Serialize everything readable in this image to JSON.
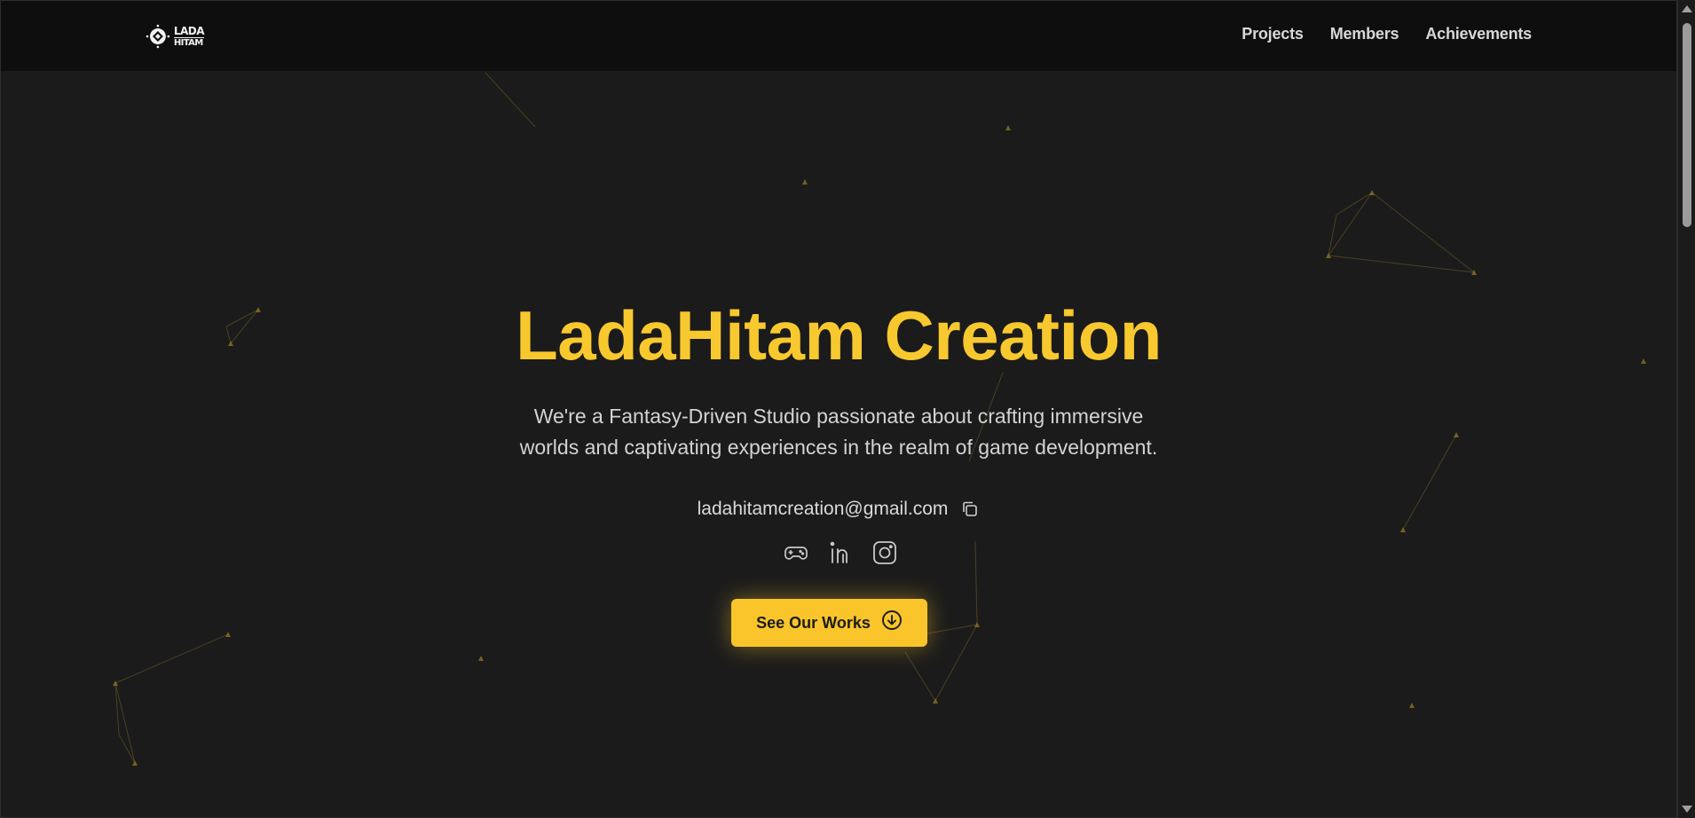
{
  "brand": {
    "logo_line1": "LADA",
    "logo_line2": "HITAM"
  },
  "nav": {
    "items": [
      {
        "label": "Projects"
      },
      {
        "label": "Members"
      },
      {
        "label": "Achievements"
      }
    ]
  },
  "hero": {
    "title": "LadaHitam Creation",
    "description_line1": "We're a Fantasy-Driven Studio passionate about crafting immersive",
    "description_line2": "worlds and captivating experiences in the realm of game development.",
    "email": "ladahitamcreation@gmail.com",
    "copy_icon": "copy-icon",
    "social_icons": [
      "gamepad-icon",
      "linkedin-icon",
      "instagram-icon"
    ],
    "cta_label": "See Our Works",
    "cta_icon": "arrow-down-circle-icon"
  },
  "colors": {
    "accent": "#f8c82f",
    "background": "#1b1b1b",
    "navbar": "#0e0e0e",
    "text": "#d3d3d3"
  }
}
